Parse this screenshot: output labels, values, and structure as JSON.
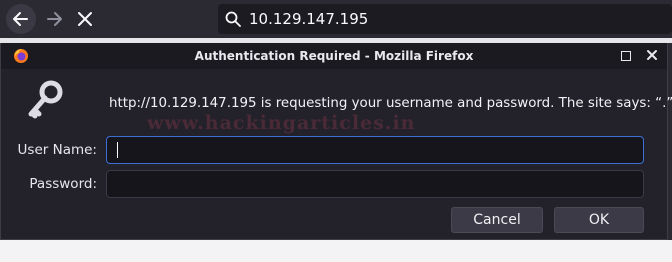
{
  "toolbar": {
    "url": "10.129.147.195"
  },
  "dialog": {
    "title": "Authentication Required - Mozilla Firefox",
    "message": "http://10.129.147.195 is requesting your username and password. The site says: “.”",
    "watermark": "www.hackingarticles.in",
    "username_label": "User Name:",
    "password_label": "Password:",
    "username_value": "",
    "password_value": "",
    "cancel_label": "Cancel",
    "ok_label": "OK"
  },
  "colors": {
    "focus_border": "#3b6fd6",
    "dialog_bg": "#23222b",
    "titlebar_bg": "#1b1a21"
  }
}
